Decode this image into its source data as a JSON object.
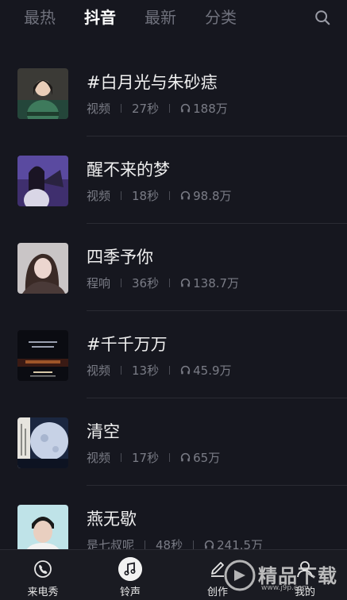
{
  "tabs": [
    {
      "label": "最热",
      "active": false
    },
    {
      "label": "抖音",
      "active": true
    },
    {
      "label": "最新",
      "active": false
    },
    {
      "label": "分类",
      "active": false
    }
  ],
  "items": [
    {
      "title": "#白月光与朱砂痣",
      "author": "视频",
      "duration": "27秒",
      "plays": "188万"
    },
    {
      "title": "醒不来的梦",
      "author": "视频",
      "duration": "18秒",
      "plays": "98.8万"
    },
    {
      "title": "四季予你",
      "author": "程响",
      "duration": "36秒",
      "plays": "138.7万"
    },
    {
      "title": "#千千万万",
      "author": "视频",
      "duration": "13秒",
      "plays": "45.9万"
    },
    {
      "title": "清空",
      "author": "视频",
      "duration": "17秒",
      "plays": "65万"
    },
    {
      "title": "燕无歇",
      "author": "是七叔呢",
      "duration": "48秒",
      "plays": "241.5万"
    }
  ],
  "nav": [
    {
      "label": "来电秀",
      "icon": "phone-show-icon"
    },
    {
      "label": "铃声",
      "icon": "music-note-icon"
    },
    {
      "label": "创作",
      "icon": "pencil-icon"
    },
    {
      "label": "我的",
      "icon": "person-icon"
    }
  ],
  "watermark": {
    "text": "精品下载",
    "url": "www.j9p.com"
  }
}
